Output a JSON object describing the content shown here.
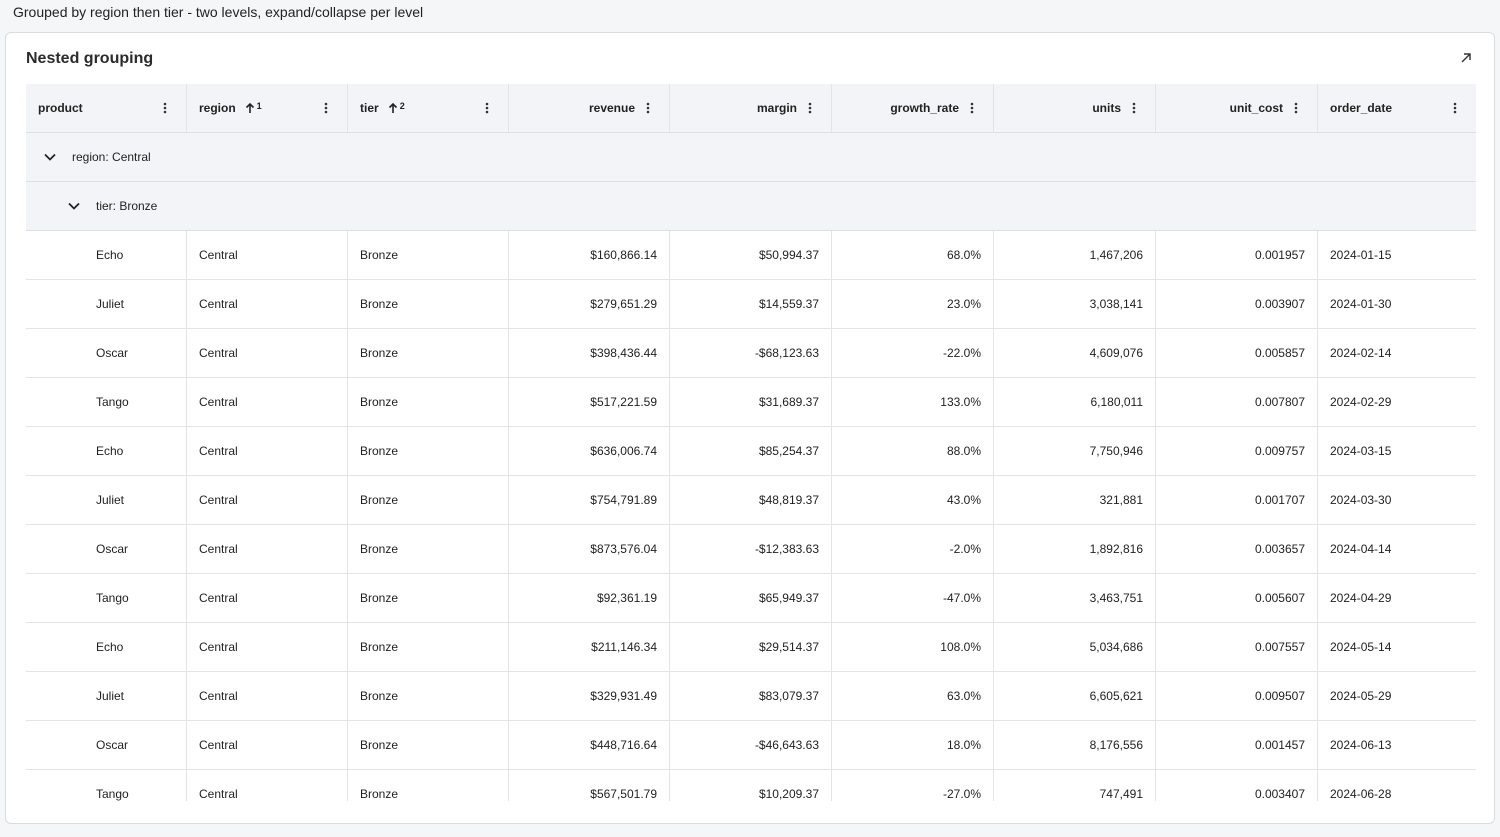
{
  "caption": "Grouped by region then tier - two levels, expand/collapse per level",
  "card": {
    "title": "Nested grouping"
  },
  "columns": [
    {
      "label": "product",
      "sort": "",
      "align": "left"
    },
    {
      "label": "region",
      "sort": "1",
      "align": "left"
    },
    {
      "label": "tier",
      "sort": "2",
      "align": "left"
    },
    {
      "label": "revenue",
      "sort": "",
      "align": "right"
    },
    {
      "label": "margin",
      "sort": "",
      "align": "right"
    },
    {
      "label": "growth_rate",
      "sort": "",
      "align": "right"
    },
    {
      "label": "units",
      "sort": "",
      "align": "right"
    },
    {
      "label": "unit_cost",
      "sort": "",
      "align": "right"
    },
    {
      "label": "order_date",
      "sort": "",
      "align": "left"
    }
  ],
  "groups": {
    "level1": "region: Central",
    "level2": "tier: Bronze"
  },
  "rows": [
    [
      "Echo",
      "Central",
      "Bronze",
      "$160,866.14",
      "$50,994.37",
      "68.0%",
      "1,467,206",
      "0.001957",
      "2024-01-15"
    ],
    [
      "Juliet",
      "Central",
      "Bronze",
      "$279,651.29",
      "$14,559.37",
      "23.0%",
      "3,038,141",
      "0.003907",
      "2024-01-30"
    ],
    [
      "Oscar",
      "Central",
      "Bronze",
      "$398,436.44",
      "-$68,123.63",
      "-22.0%",
      "4,609,076",
      "0.005857",
      "2024-02-14"
    ],
    [
      "Tango",
      "Central",
      "Bronze",
      "$517,221.59",
      "$31,689.37",
      "133.0%",
      "6,180,011",
      "0.007807",
      "2024-02-29"
    ],
    [
      "Echo",
      "Central",
      "Bronze",
      "$636,006.74",
      "$85,254.37",
      "88.0%",
      "7,750,946",
      "0.009757",
      "2024-03-15"
    ],
    [
      "Juliet",
      "Central",
      "Bronze",
      "$754,791.89",
      "$48,819.37",
      "43.0%",
      "321,881",
      "0.001707",
      "2024-03-30"
    ],
    [
      "Oscar",
      "Central",
      "Bronze",
      "$873,576.04",
      "-$12,383.63",
      "-2.0%",
      "1,892,816",
      "0.003657",
      "2024-04-14"
    ],
    [
      "Tango",
      "Central",
      "Bronze",
      "$92,361.19",
      "$65,949.37",
      "-47.0%",
      "3,463,751",
      "0.005607",
      "2024-04-29"
    ],
    [
      "Echo",
      "Central",
      "Bronze",
      "$211,146.34",
      "$29,514.37",
      "108.0%",
      "5,034,686",
      "0.007557",
      "2024-05-14"
    ],
    [
      "Juliet",
      "Central",
      "Bronze",
      "$329,931.49",
      "$83,079.37",
      "63.0%",
      "6,605,621",
      "0.009507",
      "2024-05-29"
    ],
    [
      "Oscar",
      "Central",
      "Bronze",
      "$448,716.64",
      "-$46,643.63",
      "18.0%",
      "8,176,556",
      "0.001457",
      "2024-06-13"
    ],
    [
      "Tango",
      "Central",
      "Bronze",
      "$567,501.79",
      "$10,209.37",
      "-27.0%",
      "747,491",
      "0.003407",
      "2024-06-28"
    ]
  ]
}
